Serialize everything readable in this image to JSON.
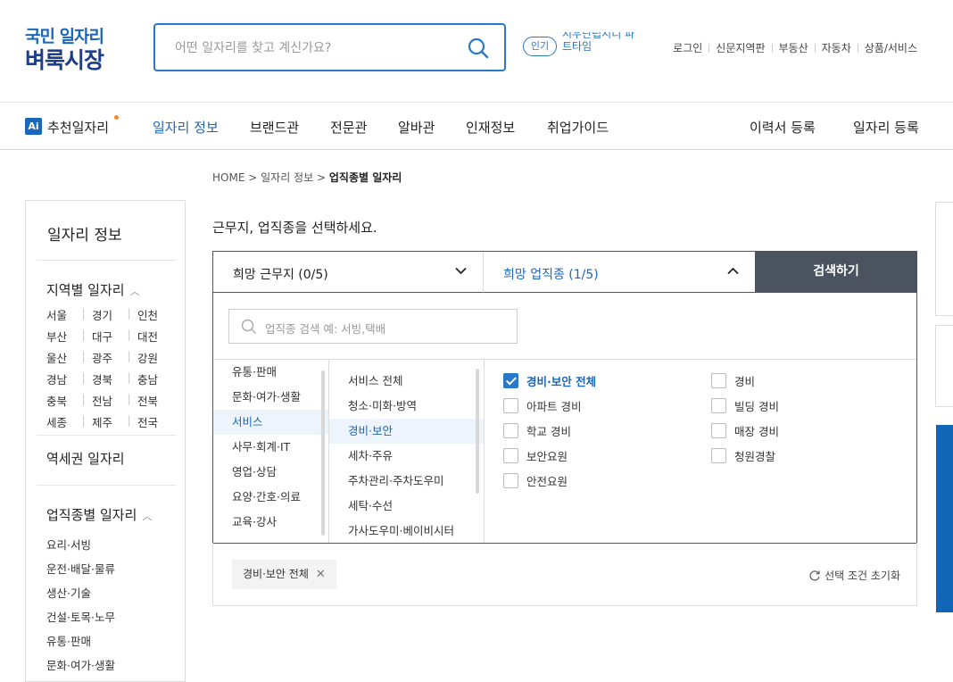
{
  "logo": {
    "line1": "국민 일자리",
    "line2": "벼룩시장"
  },
  "search": {
    "placeholder": "어떤 일자리를 찾고 계신가요?"
  },
  "popular": {
    "badge": "인기",
    "text": "시우단립시디 파트타임"
  },
  "util_links": [
    "로그인",
    "신문지역판",
    "부동산",
    "자동차",
    "상품/서비스"
  ],
  "nav": {
    "ai_badge": "Ai",
    "ai_label": "추천일자리",
    "items": [
      "일자리 정보",
      "브랜드관",
      "전문관",
      "알바관",
      "인재정보",
      "취업가이드"
    ],
    "right": [
      "이력서 등록",
      "일자리 등록"
    ]
  },
  "breadcrumb": {
    "home": "HOME",
    "sep": ">",
    "mid": "일자리 정보",
    "current": "업직종별 일자리"
  },
  "sidebar": {
    "title": "일자리 정보",
    "region_header": "지역별 일자리",
    "regions": [
      [
        "서울",
        "경기",
        "인천"
      ],
      [
        "부산",
        "대구",
        "대전"
      ],
      [
        "울산",
        "광주",
        "강원"
      ],
      [
        "경남",
        "경북",
        "충남"
      ],
      [
        "충북",
        "전남",
        "전북"
      ],
      [
        "세종",
        "제주",
        "전국"
      ]
    ],
    "station_header": "역세권 일자리",
    "job_header": "업직종별 일자리",
    "jobs": [
      "요리·서빙",
      "운전·배달·물류",
      "생산·기술",
      "건설·토목·노무",
      "유통·판매",
      "문화·여가·생활"
    ]
  },
  "main": {
    "title": "근무지, 업직종을 선택하세요.",
    "select_location": "희망 근무지 (0/5)",
    "select_job": "희망 업직종 (1/5)",
    "search_button": "검색하기",
    "job_search_placeholder": "업직종 검색 예: 서빙,택배",
    "categories": [
      "유통·판매",
      "문화·여가·생활",
      "서비스",
      "사무·회계·IT",
      "영업·상담",
      "요양·간호·의료",
      "교육·강사"
    ],
    "subcategories": [
      "서비스 전체",
      "청소·미화·방역",
      "경비·보안",
      "세차·주유",
      "주차관리·주차도우미",
      "세탁·수선",
      "가사도우미·베이비시터"
    ],
    "options_left": [
      "경비·보안 전체",
      "아파트 경비",
      "학교 경비",
      "보안요원",
      "안전요원"
    ],
    "options_right": [
      "경비",
      "빌딩 경비",
      "매장 경비",
      "청원경찰"
    ],
    "selected_tag": "경비·보안 전체",
    "reset_label": "선택 조건 초기화"
  },
  "colors": {
    "accent": "#1a66b8",
    "button": "#4b5360"
  }
}
